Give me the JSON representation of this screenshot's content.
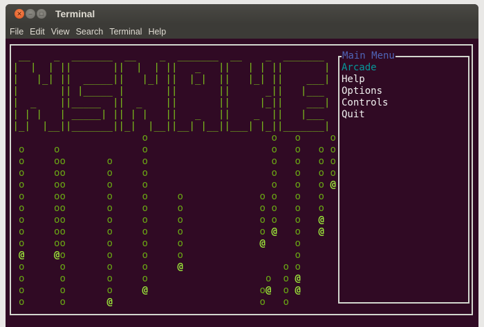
{
  "window": {
    "title": "Terminal"
  },
  "menubar": [
    "File",
    "Edit",
    "View",
    "Search",
    "Terminal",
    "Help"
  ],
  "logo_rows": [
    "  __    _  _______  __    _  _______  __    _  _______ ",
    " |  |  | ||       ||  |  | ||   _   ||   | | ||       |",
    " |   |_| ||  _____||   |_| ||  |_|  ||   |_| ||    ___|",
    " |       || |_____ |       ||       ||      _||   |___ ",
    " |  _    ||_____  ||  _    ||       ||     |_||    ___|",
    " | | |   | _____| || | |   ||   _   ||    _  ||   |___ ",
    " |_|  |__||_______||_|  |__||__| |__||___| |_||_______|"
  ],
  "playfield_rows": [
    "                       o                     o   o     o",
    "  o     o              o                     o   o   o o",
    "  o     oo       o     o                     o   o   o o",
    "  o     oo       o     o                     o   o   o o",
    "  o     oo       o     o                     o   o   o @",
    "  o     oo       o     o     o             o o   o   o",
    "  o     oo       o     o     o             o o   o   o",
    "  o     oo       o     o     o             o o   o   @",
    "  o     oo       o     o     o             o @   o   @",
    "  o     oo       o     o     o             @     o",
    "  @     @o       o     o     o                   o",
    "  o      o       o     o     @                 o o",
    "  o      o       o     o                    o  o @",
    "  o      o       o     @                   o@  o @",
    "  o      o       @                         o   o"
  ],
  "main_menu": {
    "title": "Main Menu",
    "items": [
      "Arcade",
      "Help",
      "Options",
      "Controls",
      "Quit"
    ],
    "selected": "Arcade"
  },
  "colors": {
    "background": "#300a24",
    "snake_body": "#6aa814",
    "snake_head": "#9be53a",
    "logo": "#7ec41c",
    "menu_title": "#4f64b6",
    "menu_selected": "#06989a"
  }
}
